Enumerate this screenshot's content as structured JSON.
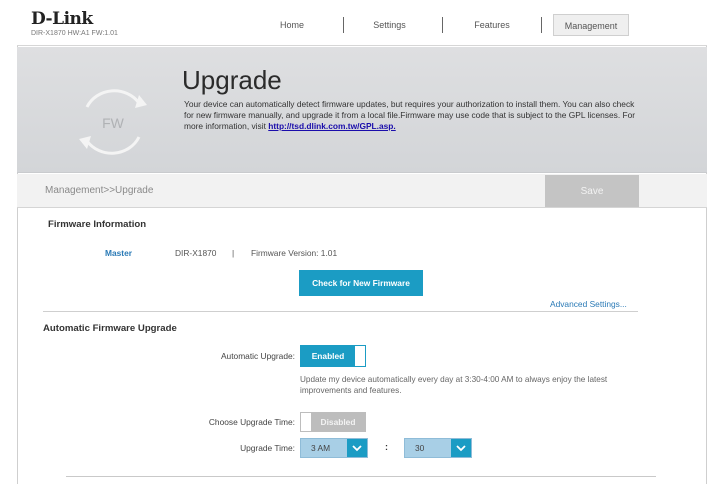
{
  "brand": {
    "logo": "D-Link",
    "model_line": "DIR-X1870 HW:A1 FW:1.01"
  },
  "nav": {
    "home": "Home",
    "settings": "Settings",
    "features": "Features",
    "management": "Management"
  },
  "hero": {
    "icon_text": "FW",
    "title": "Upgrade",
    "description": "Your device can automatically detect firmware updates, but requires your authorization to install them. You can also check for new firmware manually, and upgrade it from a local file.Firmware may use code that is subject to the GPL licenses. For more information, visit ",
    "link": "http://tsd.dlink.com.tw/GPL.asp."
  },
  "breadcrumb": "Management>>Upgrade",
  "save_label": "Save",
  "firmware_info": {
    "title": "Firmware Information",
    "master": "Master",
    "model": "DIR-X1870",
    "separator": "|",
    "version": "Firmware Version: 1.01",
    "check_button": "Check for New Firmware",
    "advanced_link": "Advanced Settings..."
  },
  "auto_upgrade": {
    "title": "Automatic Firmware Upgrade",
    "auto_label": "Automatic Upgrade:",
    "auto_state": "Enabled",
    "help": "Update my device automatically every day at 3:30-4:00 AM to always enjoy the latest improvements and features.",
    "choose_label": "Choose Upgrade Time:",
    "choose_state": "Disabled",
    "time_label": "Upgrade Time:",
    "hour": "3 AM",
    "colon": ":",
    "minute": "30"
  },
  "colors": {
    "accent": "#1b9cc4",
    "disabled": "#bdbdbd",
    "select_bg": "#a8cfe6"
  }
}
